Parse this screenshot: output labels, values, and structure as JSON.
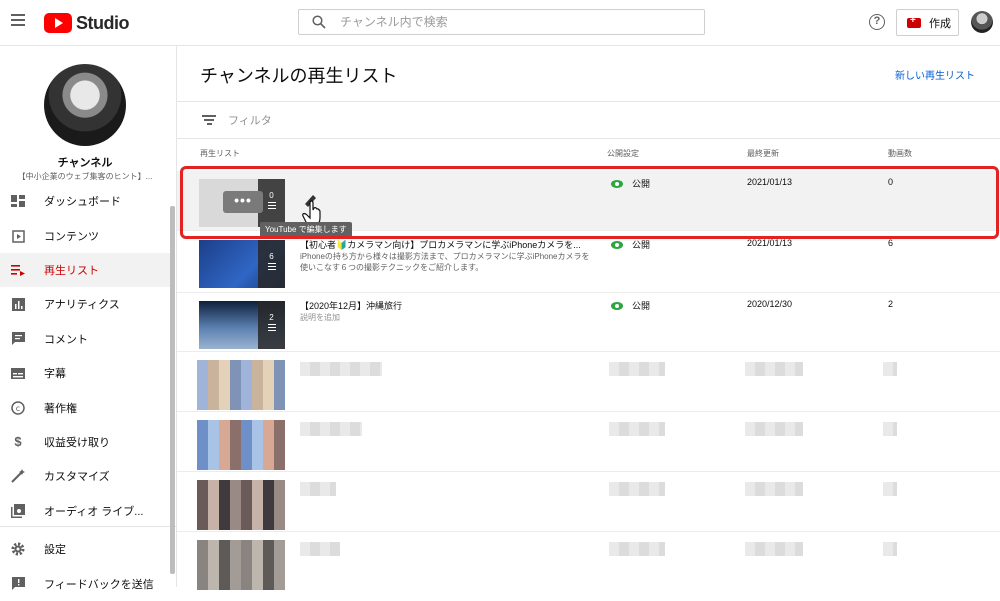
{
  "header": {
    "logo_text": "Studio",
    "search_placeholder": "チャンネル内で検索",
    "help_label": "?",
    "create_label": "作成"
  },
  "sidebar": {
    "channel_name": "チャンネル",
    "channel_subtitle": "【中小企業のウェブ集客のヒント】...",
    "items": [
      {
        "label": "ダッシュボード",
        "icon": "dashboard-icon"
      },
      {
        "label": "コンテンツ",
        "icon": "content-icon"
      },
      {
        "label": "再生リスト",
        "icon": "playlist-icon",
        "active": true
      },
      {
        "label": "アナリティクス",
        "icon": "analytics-icon"
      },
      {
        "label": "コメント",
        "icon": "comment-icon"
      },
      {
        "label": "字幕",
        "icon": "subtitles-icon"
      },
      {
        "label": "著作権",
        "icon": "copyright-icon"
      },
      {
        "label": "収益受け取り",
        "icon": "dollar-icon"
      },
      {
        "label": "カスタマイズ",
        "icon": "magic-wand-icon"
      },
      {
        "label": "オーディオ ライブ...",
        "icon": "audio-library-icon"
      }
    ],
    "bottom_items": [
      {
        "label": "設定",
        "icon": "gear-icon"
      },
      {
        "label": "フィードバックを送信",
        "icon": "feedback-icon"
      }
    ]
  },
  "main": {
    "title": "チャンネルの再生リスト",
    "new_playlist": "新しい再生リスト",
    "filter_placeholder": "フィルタ",
    "columns": {
      "playlist": "再生リスト",
      "visibility": "公開設定",
      "updated": "最終更新",
      "count": "動画数"
    },
    "rows": [
      {
        "title": "",
        "desc": "",
        "count_badge": "0",
        "visibility": "公開",
        "updated": "2021/01/13",
        "videos": "0"
      },
      {
        "title": "【初心者🔰カメラマン向け】プロカメラマンに学ぶiPhoneカメラを...",
        "desc": "iPhoneの持ち方から様々は撮影方法まで、プロカメラマンに学ぶiPhoneカメラを使いこなす６つの撮影テクニックをご紹介します。",
        "count_badge": "6",
        "visibility": "公開",
        "updated": "2021/01/13",
        "videos": "6"
      },
      {
        "title": "【2020年12月】沖縄旅行",
        "desc": "説明を追加",
        "count_badge": "2",
        "visibility": "公開",
        "updated": "2020/12/30",
        "videos": "2"
      }
    ],
    "tooltip": "YouTube で編集します",
    "options_label": "•••"
  },
  "colors": {
    "brand_red": "#ff0000",
    "active_red": "#cc0000",
    "link_blue": "#065fd4",
    "public_green": "#2ba640",
    "highlight_red": "#e32222"
  }
}
